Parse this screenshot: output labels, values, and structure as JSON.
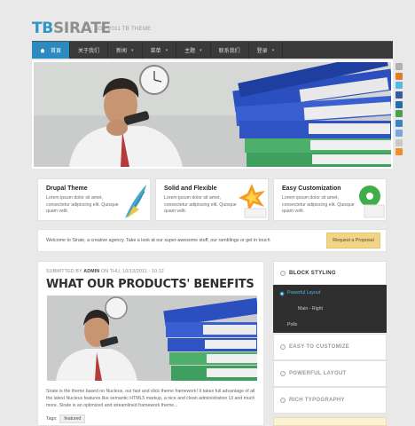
{
  "brand": {
    "logo_prefix": "TB",
    "logo_main": "SIRATE",
    "tagline": "NOV 2011 TB THEME"
  },
  "nav": {
    "items": [
      {
        "label": "首頁",
        "active": true,
        "dropdown": false
      },
      {
        "label": "关于我们",
        "active": false,
        "dropdown": false
      },
      {
        "label": "新闻",
        "active": false,
        "dropdown": true
      },
      {
        "label": "菜单",
        "active": false,
        "dropdown": true
      },
      {
        "label": "主题",
        "active": false,
        "dropdown": true
      },
      {
        "label": "联系我们",
        "active": false,
        "dropdown": false
      },
      {
        "label": "登录",
        "active": false,
        "dropdown": true
      }
    ]
  },
  "social": {
    "icons": [
      "mail-icon",
      "rss-icon",
      "twitter-icon",
      "facebook-icon",
      "digg-icon",
      "delicious-icon",
      "stumble-icon",
      "google-icon",
      "share-icon",
      "feed-icon"
    ]
  },
  "features": [
    {
      "title": "Drupal Theme",
      "text": "Lorem ipsum dolor sit amet, consectetur adipiscing elit. Quisque quam velit."
    },
    {
      "title": "Solid and Flexible",
      "text": "Lorem ipsum dolor sit amet, consectetur adipiscing elit. Quisque quam velit."
    },
    {
      "title": "Easy Customization",
      "text": "Lorem ipsum dolor sit amet, consectetur adipiscing elit. Quisque quam velit."
    }
  ],
  "welcome": {
    "text": "Welcome to Sirate, a creative agency. Take a look at our super-awesome stuff, our ramblings or get in touch",
    "button": "Request a Proposal"
  },
  "article": {
    "meta_prefix": "SUBMITTED BY",
    "author": "ADMIN",
    "meta_suffix": "ON THU, 10/13/2011 - 10:12",
    "title": "WHAT OUR PRODUCTS' BENEFITS",
    "excerpt": "Sirate is the theme based on Nucleus, our fast and slick theme framework! It takes full advantage of all the latest Nucleus features like semantic HTML5 markup, a nice and clean administration UI and much more. Sirate is an optimized and streamlined framework theme...",
    "tags_label": "Tags:",
    "tag": "featured"
  },
  "sidebar": {
    "block_styling": "BLOCK STYLING",
    "menu": [
      {
        "label": "Powerful Layout",
        "active": true
      },
      {
        "label": "Main - Right",
        "active": false
      },
      {
        "label": "Polls",
        "active": false
      }
    ],
    "sections": [
      "EASY TO CUSTOMIZE",
      "POWERFUL LAYOUT",
      "RICH TYPOGRAPHY"
    ]
  },
  "colors": {
    "accent": "#2b8bc0",
    "nav_bg": "#3a3a3a",
    "proposal": "#f2d488"
  }
}
